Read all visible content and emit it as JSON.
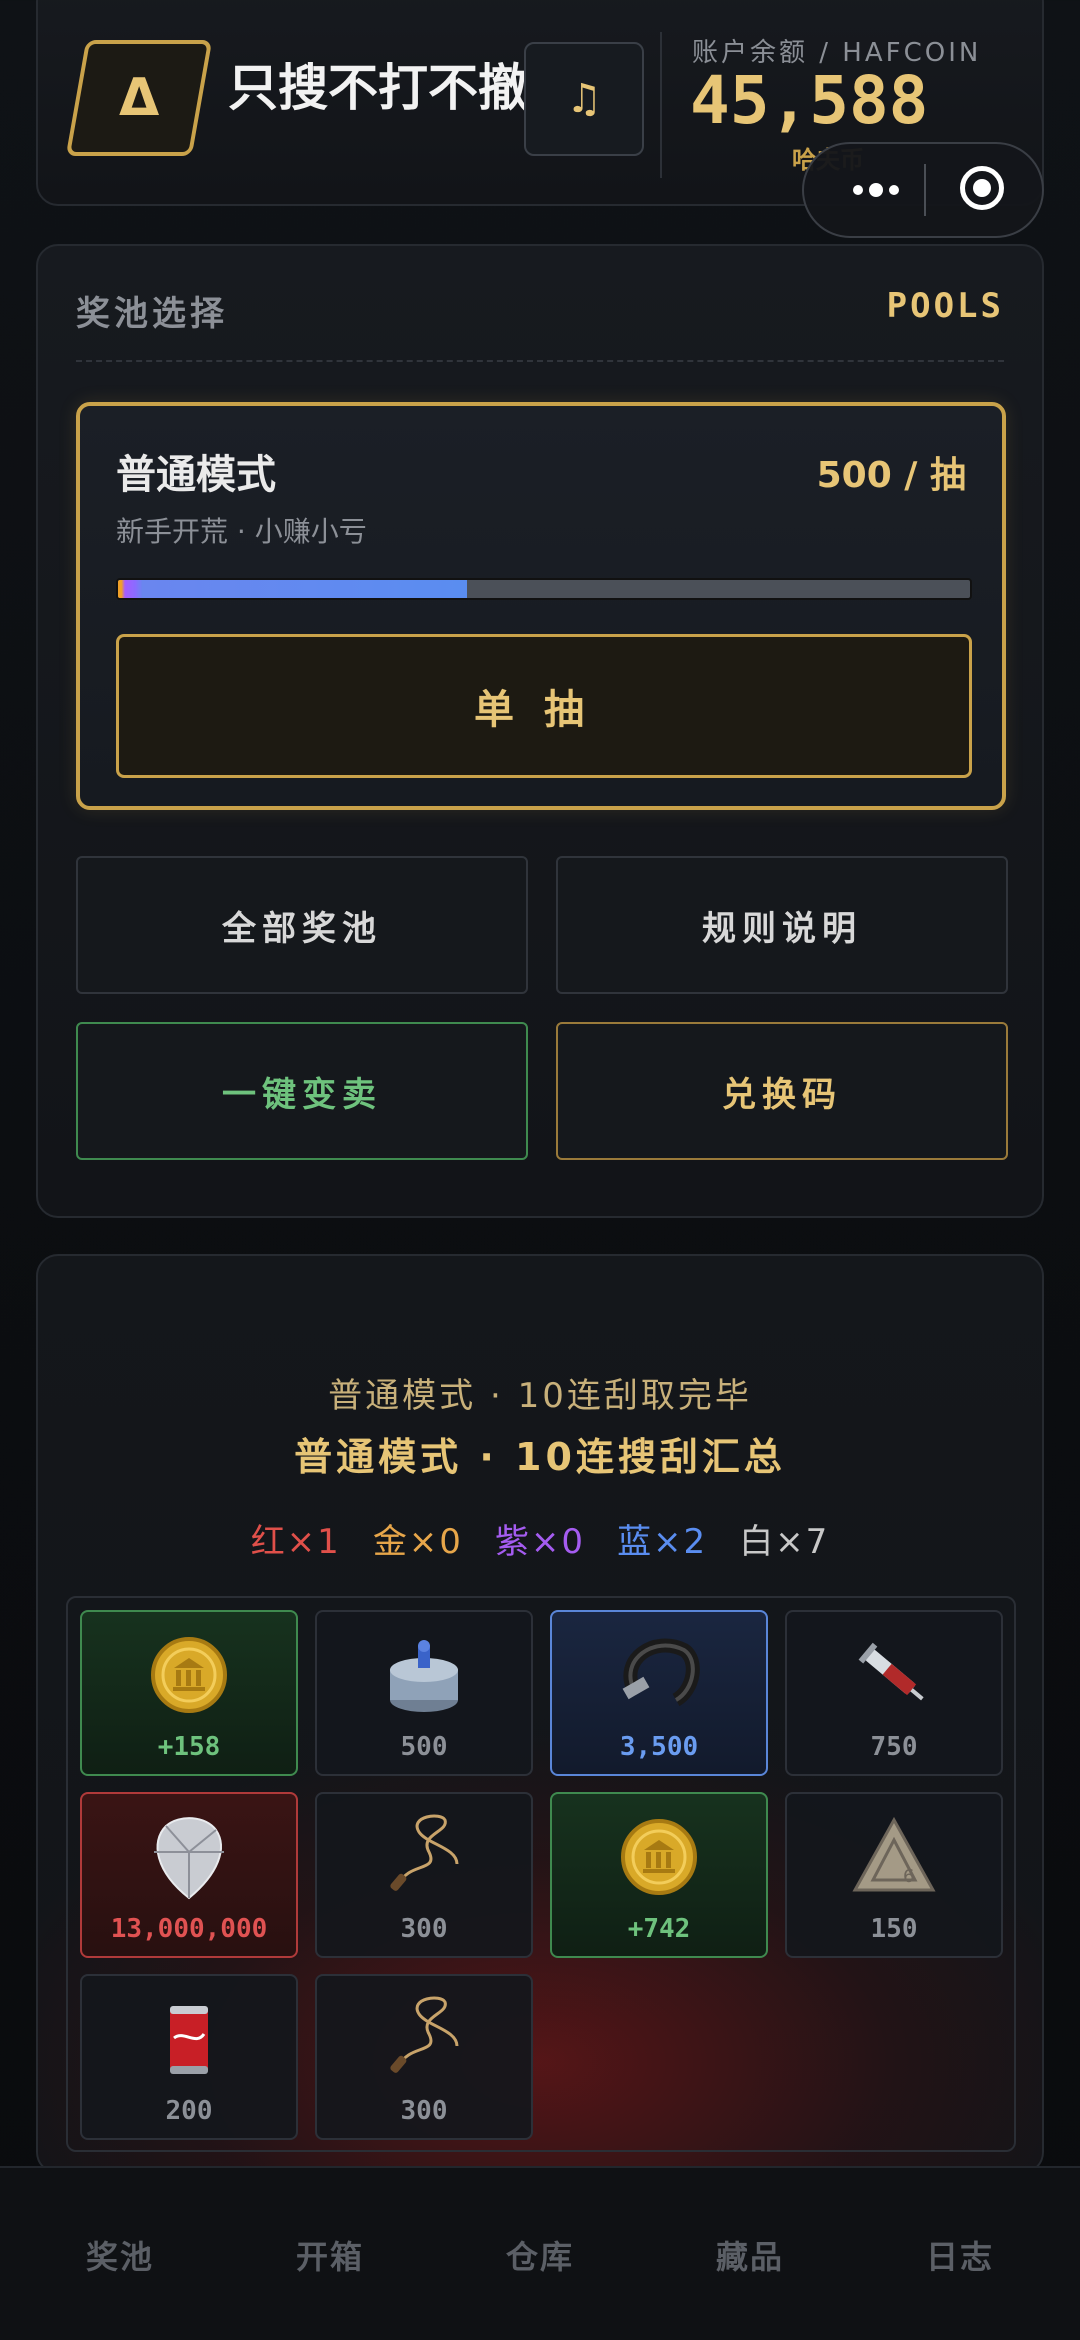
{
  "header": {
    "logo_glyph": "Δ",
    "app_title": "只搜不打不撤",
    "music_glyph": "♫",
    "balance_label": "账户余额 / HAFCOIN",
    "balance_value": "45,588",
    "balance_unit": "哈夫币"
  },
  "pools": {
    "section_title": "奖池选择",
    "section_title_en": "POOLS",
    "mode": {
      "name": "普通模式",
      "price": "500 / 抽",
      "description": "新手开荒 · 小赚小亏",
      "progress_fraction": 0.41,
      "single_draw_label": "单抽"
    },
    "buttons": {
      "all_pools": "全部奖池",
      "rules": "规则说明",
      "sell_all": "一键变卖",
      "redeem_code": "兑换码"
    }
  },
  "results": {
    "subtitle": "普通模式 · 10连刮取完毕",
    "title": "普通模式 · 10连搜刮汇总",
    "counts": [
      {
        "label": "红×1",
        "color": "#e0504a"
      },
      {
        "label": "金×0",
        "color": "#e7a64a"
      },
      {
        "label": "紫×0",
        "color": "#a55cf0"
      },
      {
        "label": "蓝×2",
        "color": "#5a8df0"
      },
      {
        "label": "白×7",
        "color": "#c8c8c8"
      }
    ],
    "items": [
      {
        "icon": "gold-coin-icon",
        "value": "+158",
        "rarity": "green"
      },
      {
        "icon": "fuel-canister-icon",
        "value": "500",
        "rarity": "white"
      },
      {
        "icon": "watch-strap-icon",
        "value": "3,500",
        "rarity": "blue"
      },
      {
        "icon": "syringe-icon",
        "value": "750",
        "rarity": "white"
      },
      {
        "icon": "diamond-icon",
        "value": "13,000,000",
        "rarity": "red"
      },
      {
        "icon": "coiled-cable-icon",
        "value": "300",
        "rarity": "white"
      },
      {
        "icon": "gold-coin-icon",
        "value": "+742",
        "rarity": "green"
      },
      {
        "icon": "triangle-badge-icon",
        "value": "150",
        "rarity": "white"
      },
      {
        "icon": "cola-can-icon",
        "value": "200",
        "rarity": "white"
      },
      {
        "icon": "coiled-cable-icon",
        "value": "300",
        "rarity": "white"
      }
    ]
  },
  "nav": {
    "tabs": [
      "奖池",
      "开箱",
      "仓库",
      "藏品",
      "日志"
    ]
  }
}
